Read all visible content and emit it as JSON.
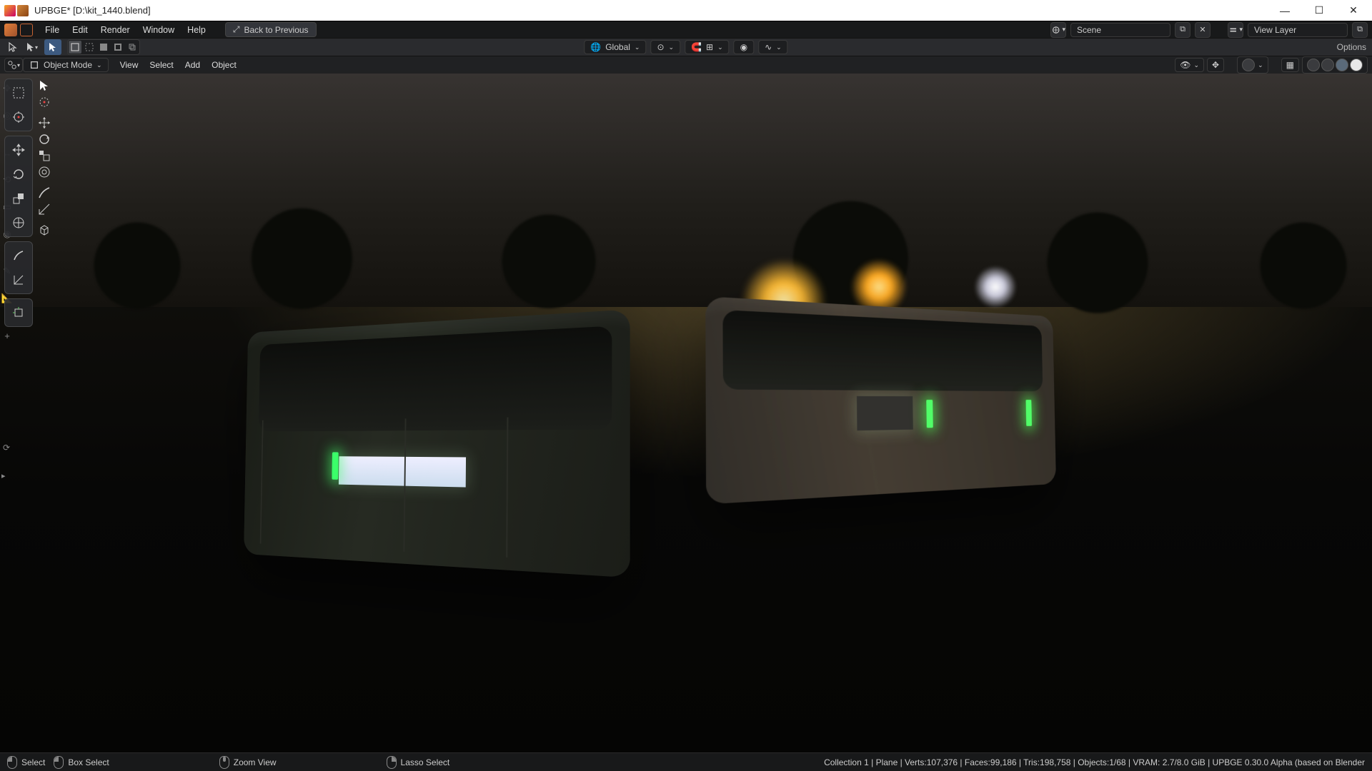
{
  "title": "UPBGE* [D:\\kit_1440.blend]",
  "menu": {
    "file": "File",
    "edit": "Edit",
    "render": "Render",
    "window": "Window",
    "help": "Help",
    "back": "Back to Previous"
  },
  "scene": {
    "label": "Scene"
  },
  "viewlayer": {
    "label": "View Layer"
  },
  "toolhdr": {
    "orient": "Global",
    "options": "Options"
  },
  "viewhdr": {
    "mode": "Object Mode",
    "view": "View",
    "select": "Select",
    "add": "Add",
    "object": "Object"
  },
  "status": {
    "select": "Select",
    "box": "Box Select",
    "zoom": "Zoom View",
    "lasso": "Lasso Select",
    "info": "Collection 1 | Plane | Verts:107,376 | Faces:99,186 | Tris:198,758 | Objects:1/68 | VRAM: 2.7/8.0 GiB | UPBGE 0.30.0 Alpha (based on Blender"
  },
  "tools": {
    "select_box": "select-box",
    "cursor": "cursor",
    "move": "move",
    "rotate": "rotate",
    "scale": "scale",
    "transform": "transform",
    "annotate": "annotate",
    "measure": "measure",
    "add_primitive": "add-primitive"
  }
}
